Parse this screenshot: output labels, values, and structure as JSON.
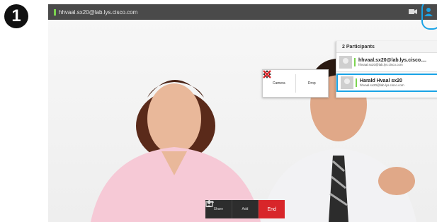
{
  "step": {
    "number": "1"
  },
  "top_bar": {
    "call_address": "hhvaal.sx20@lab.lys.cisco.com",
    "status_color": "#7bd34f",
    "icons": [
      "camera-icon",
      "participants-icon"
    ]
  },
  "context_menu": {
    "items": [
      {
        "label": "Camera",
        "icon": "move-arrows-icon"
      },
      {
        "label": "Drop",
        "icon": "red-x-icon"
      }
    ]
  },
  "participants_panel": {
    "header": "2 Participants",
    "items": [
      {
        "name": "hhvaal.sx20@lab.lys.cisco....",
        "uri": "hhvaal.sx20@lab.lys.cisco.com",
        "selected": false
      },
      {
        "name": "Harald Hvaal sx20",
        "uri": "hhvaal.sx20@lab.lys.cisco.com",
        "selected": true
      }
    ]
  },
  "call_bar": {
    "share_label": "Share",
    "add_label": "Add",
    "end_label": "End",
    "end_color": "#d8262a"
  },
  "accent_color": "#1aa3e6"
}
